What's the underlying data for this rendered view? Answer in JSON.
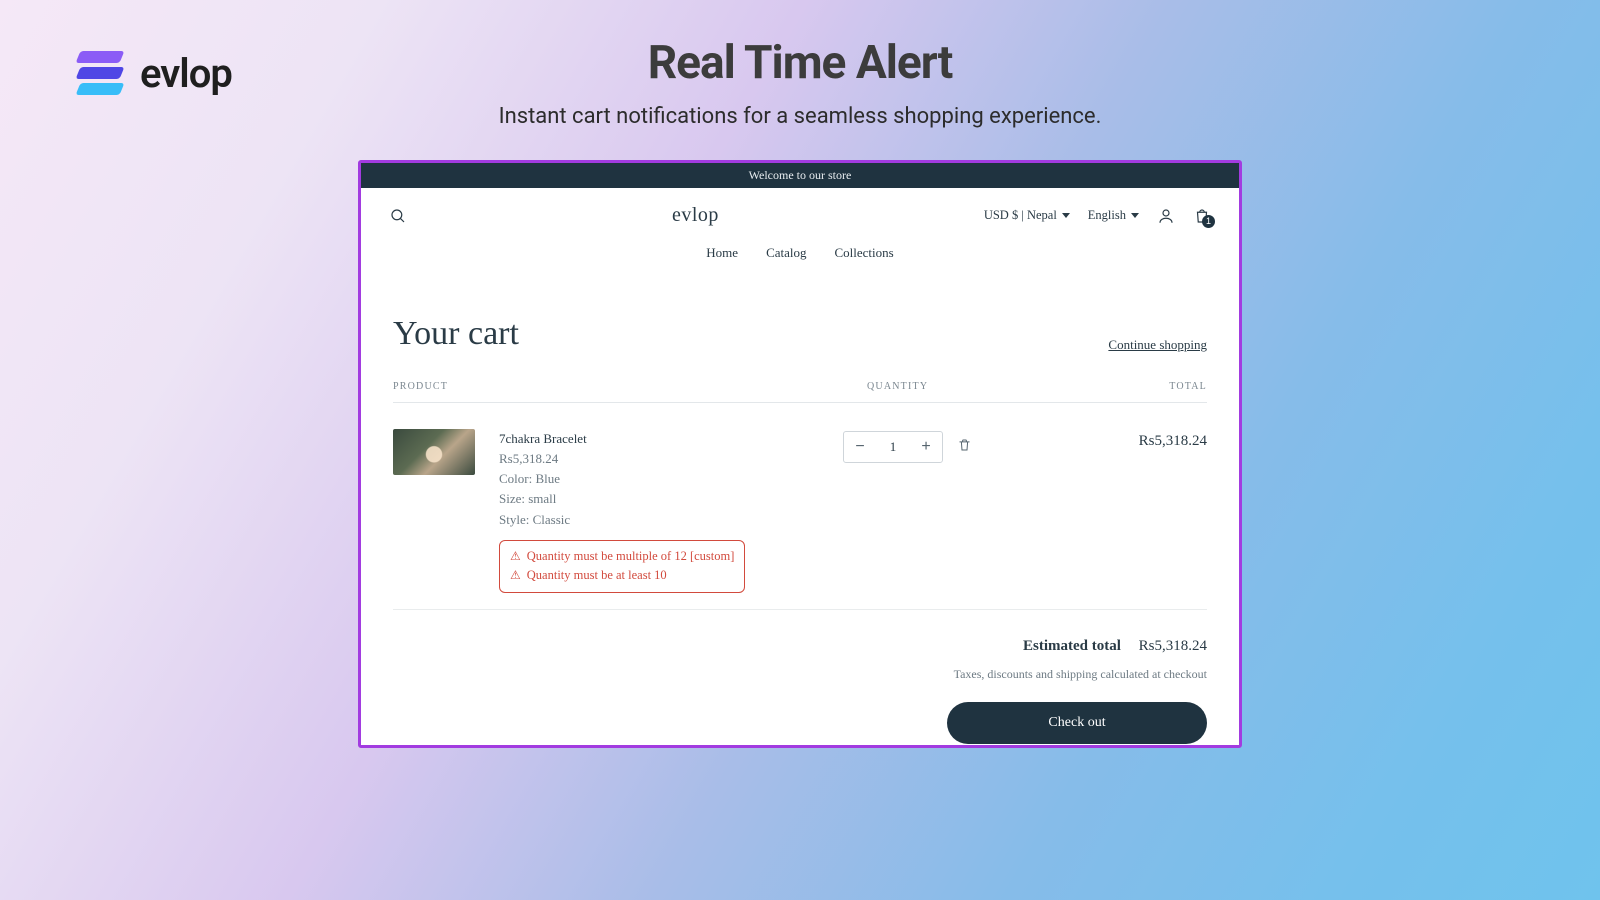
{
  "brand": {
    "word": "evlop"
  },
  "hero": {
    "title": "Real Time Alert",
    "subtitle": "Instant cart notifications for a seamless shopping experience."
  },
  "store": {
    "announcement": "Welcome to our store",
    "logo_text": "evlop",
    "currency_selector": "USD $ | Nepal",
    "language_selector": "English",
    "cart_count": "1",
    "nav": {
      "home": "Home",
      "catalog": "Catalog",
      "collections": "Collections"
    }
  },
  "cart": {
    "title": "Your cart",
    "continue_label": "Continue shopping",
    "columns": {
      "product": "PRODUCT",
      "quantity": "QUANTITY",
      "total": "TOTAL"
    },
    "item": {
      "name": "7chakra Bracelet",
      "price": "Rs5,318.24",
      "opt_color": "Color: Blue",
      "opt_size": "Size: small",
      "opt_style": "Style: Classic",
      "qty": "1",
      "line_total": "Rs5,318.24",
      "alerts": {
        "a": "Quantity must be multiple of 12 [custom]",
        "b": "Quantity must be at least 10"
      }
    },
    "footer": {
      "estimated_label": "Estimated total",
      "estimated_value": "Rs5,318.24",
      "tax_note": "Taxes, discounts and shipping calculated at checkout",
      "checkout_label": "Check out"
    }
  }
}
